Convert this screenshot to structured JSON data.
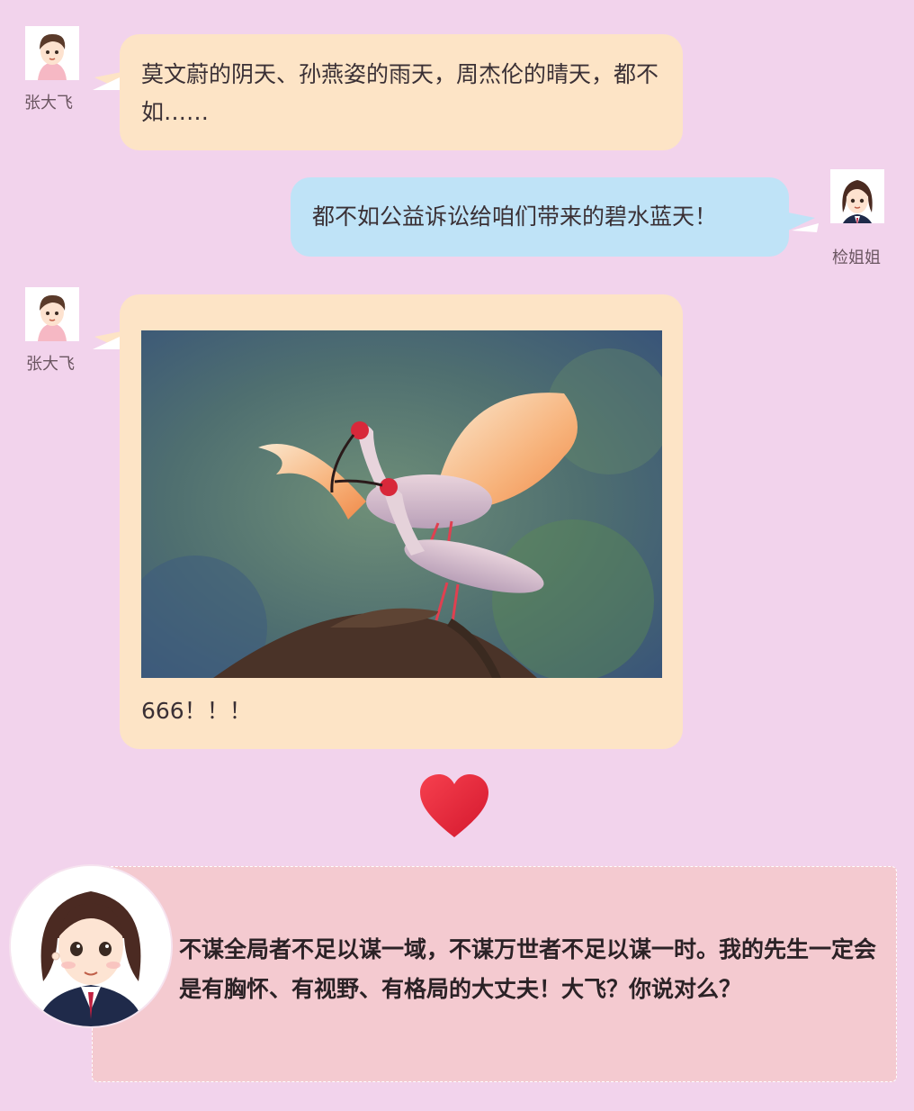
{
  "messages": [
    {
      "sender": "张大飞",
      "side": "left",
      "text": "莫文蔚的阴天、孙燕姿的雨天，周杰伦的晴天，都不如……"
    },
    {
      "sender": "检姐姐",
      "side": "right",
      "text": "都不如公益诉讼给咱们带来的碧水蓝天！"
    },
    {
      "sender": "张大飞",
      "side": "left",
      "image": "crested-ibis-pair-on-branch",
      "text": "666！！！"
    }
  ],
  "divider_icon": "heart-icon",
  "quote": {
    "text": "不谋全局者不足以谋一域，不谋万世者不足以谋一时。我的先生一定会是有胸怀、有视野、有格局的大丈夫！大飞？你说对么？"
  },
  "colors": {
    "background": "#f2d3ec",
    "bubble_left": "#fde4c6",
    "bubble_right": "#bfe3f7",
    "quote_card": "#f4cad0",
    "heart": "#e8283c"
  }
}
